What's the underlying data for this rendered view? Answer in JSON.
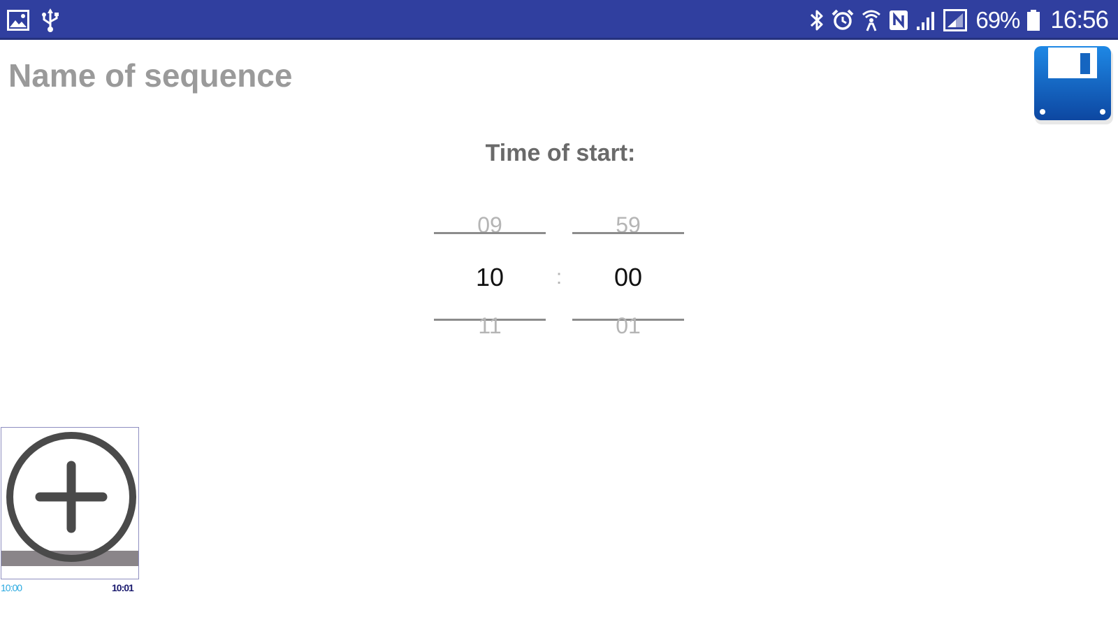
{
  "status_bar": {
    "background_color": "#303f9f",
    "left_icons": [
      "gallery-icon",
      "usb-icon"
    ],
    "right_icons": [
      "bluetooth-icon",
      "alarm-icon",
      "wifi-calling-icon",
      "nfc-icon",
      "signal-icon",
      "data-signal-icon",
      "battery-icon"
    ],
    "battery_percent": "69%",
    "time": "16:56"
  },
  "sequence": {
    "name_placeholder": "Name of sequence",
    "name_value": ""
  },
  "save": {
    "icon": "floppy-disk-icon",
    "color": "#1565c0"
  },
  "time_picker": {
    "label": "Time of start:",
    "separator": ":",
    "hours": {
      "prev": "09",
      "current": "10",
      "next": "11"
    },
    "minutes": {
      "prev": "59",
      "current": "00",
      "next": "01"
    }
  },
  "sequence_item": {
    "add_icon": "plus-circle-icon",
    "start_time": "10:00",
    "end_time": "10:01",
    "start_time_color": "#29a9e0",
    "end_time_color": "#1a1a6e"
  }
}
